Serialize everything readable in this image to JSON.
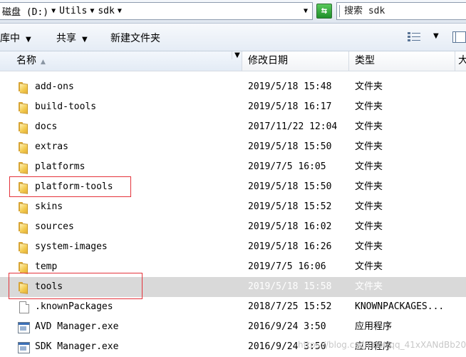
{
  "address": {
    "crumbs": [
      "磁盘 (D:)",
      "Utils",
      "sdk"
    ],
    "search_placeholder": "搜索 sdk"
  },
  "toolbar": {
    "library_label": "库中",
    "share_label": "共享",
    "new_folder_label": "新建文件夹"
  },
  "columns": {
    "name": "名称",
    "date": "修改日期",
    "type": "类型",
    "size": "大"
  },
  "files": [
    {
      "name": "add-ons",
      "date": "2019/5/18 15:48",
      "type": "文件夹",
      "icon": "folder-icon"
    },
    {
      "name": "build-tools",
      "date": "2019/5/18 16:17",
      "type": "文件夹",
      "icon": "folder-icon"
    },
    {
      "name": "docs",
      "date": "2017/11/22 12:04",
      "type": "文件夹",
      "icon": "folder-icon"
    },
    {
      "name": "extras",
      "date": "2019/5/18 15:50",
      "type": "文件夹",
      "icon": "folder-icon"
    },
    {
      "name": "platforms",
      "date": "2019/7/5 16:05",
      "type": "文件夹",
      "icon": "folder-icon"
    },
    {
      "name": "platform-tools",
      "date": "2019/5/18 15:50",
      "type": "文件夹",
      "icon": "folder-icon",
      "highlighted": true
    },
    {
      "name": "skins",
      "date": "2019/5/18 15:52",
      "type": "文件夹",
      "icon": "folder-icon"
    },
    {
      "name": "sources",
      "date": "2019/5/18 16:02",
      "type": "文件夹",
      "icon": "folder-icon"
    },
    {
      "name": "system-images",
      "date": "2019/5/18 16:26",
      "type": "文件夹",
      "icon": "folder-icon"
    },
    {
      "name": "temp",
      "date": "2019/7/5 16:06",
      "type": "文件夹",
      "icon": "folder-icon"
    },
    {
      "name": "tools",
      "date": "2019/5/18 15:58",
      "type": "文件夹",
      "icon": "folder-icon",
      "selected": true,
      "highlighted": true
    },
    {
      "name": ".knownPackages",
      "date": "2018/7/25 15:52",
      "type": "KNOWNPACKAGES...",
      "icon": "file-icon"
    },
    {
      "name": "AVD Manager.exe",
      "date": "2016/9/24 3:50",
      "type": "应用程序",
      "icon": "exe-icon"
    },
    {
      "name": "SDK Manager.exe",
      "date": "2016/9/24 3:50",
      "type": "应用程序",
      "icon": "exe-icon"
    }
  ],
  "watermark": "https://blog.csdn.net/qq_41xXANdBb20"
}
